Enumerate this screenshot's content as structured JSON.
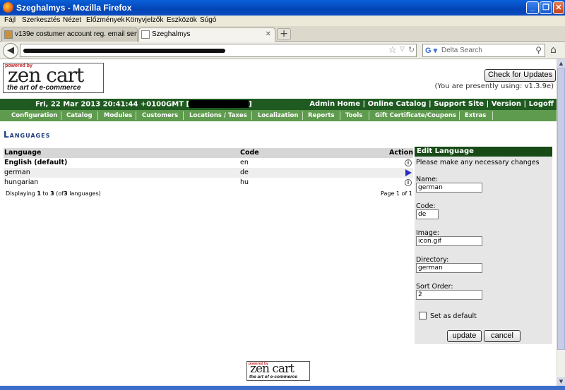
{
  "window": {
    "title": "Szeghalmys - Mozilla Firefox",
    "minimize": "_",
    "restore": "❐",
    "close": "✕"
  },
  "menu": [
    "Fájl",
    "Szerkesztés",
    "Nézet",
    "Előzmények",
    "Könyvjelzők",
    "Eszközök",
    "Súgó"
  ],
  "tabs": [
    {
      "label": "v139e costumer account reg. email sent i...",
      "close": "✕"
    },
    {
      "label": "Szeghalmys",
      "close": "✕"
    }
  ],
  "newtab": "+",
  "browser": {
    "search_placeholder": "Delta Search",
    "back_icon": "arrow-left",
    "home_icon": "home"
  },
  "logo": {
    "powered_by": "powered by",
    "brand": "zen cart",
    "tagline": "the art of e-commerce"
  },
  "header": {
    "check_updates": "Check for Updates",
    "using": "(You are presently using: v1.3.9e)",
    "date": "Fri, 22 Mar 2013 20:41:44 +0100GMT [",
    "date_end": "]",
    "links": [
      "Admin Home",
      "Online Catalog",
      "Support Site",
      "Version",
      "Logoff"
    ],
    "separator": "|"
  },
  "nav": [
    "Configuration",
    "Catalog",
    "Modules",
    "Customers",
    "Locations / Taxes",
    "Localization",
    "Reports",
    "Tools",
    "Gift Certificate/Coupons",
    "Extras"
  ],
  "page_title": "Languages",
  "table": {
    "headers": {
      "language": "Language",
      "code": "Code",
      "action": "Action"
    },
    "rows": [
      {
        "language": "English (default)",
        "code": "en",
        "action": "info"
      },
      {
        "language": "german",
        "code": "de",
        "action": "selected"
      },
      {
        "language": "hungarian",
        "code": "hu",
        "action": "info"
      }
    ],
    "info_glyph": "i",
    "displaying": {
      "prefix": "Displaying",
      "from": "1",
      "to_word": "to",
      "to": "3",
      "of_open": "(of",
      "total": "3",
      "suffix": "languages)"
    },
    "page_info": "Page 1 of 1"
  },
  "edit": {
    "heading": "Edit Language",
    "intro": "Please make any necessary changes",
    "name_label": "Name:",
    "name_value": "german",
    "code_label": "Code:",
    "code_value": "de",
    "image_label": "Image:",
    "image_value": "icon.gif",
    "directory_label": "Directory:",
    "directory_value": "german",
    "sort_label": "Sort Order:",
    "sort_value": "2",
    "default_label": "Set as default",
    "update": "update",
    "cancel": "cancel"
  }
}
